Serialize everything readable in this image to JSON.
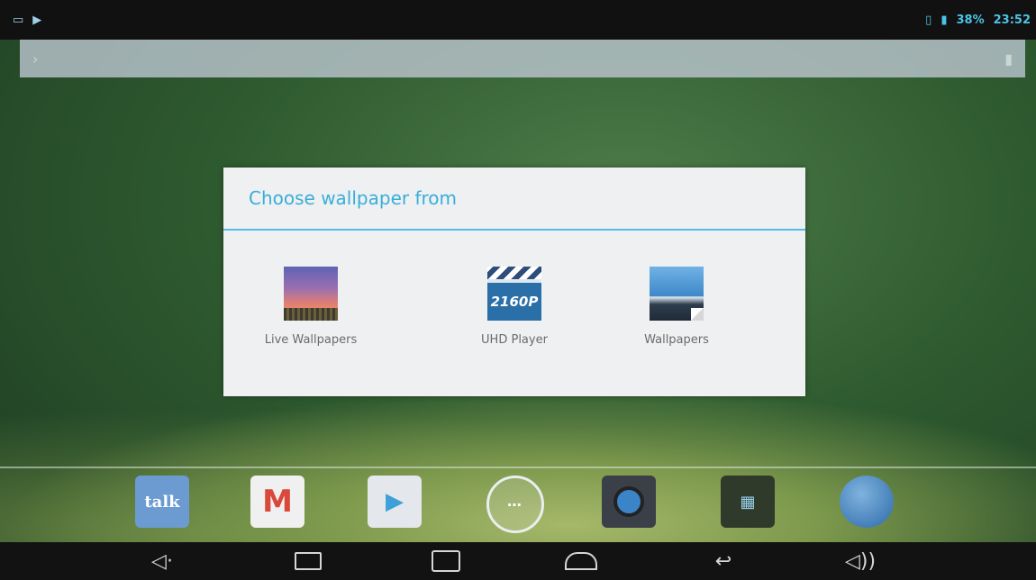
{
  "statusbar": {
    "battery_text": "38%",
    "time": "23:52"
  },
  "dialog": {
    "title": "Choose wallpaper from",
    "options": [
      {
        "label": "Live Wallpapers",
        "icon": "live-wallpapers-icon"
      },
      {
        "label": "UHD Player",
        "icon": "uhd-player-icon",
        "icon_text": "2160P"
      },
      {
        "label": "Wallpapers",
        "icon": "wallpapers-icon"
      }
    ]
  },
  "dock": {
    "items": [
      {
        "name": "talk",
        "text": "talk"
      },
      {
        "name": "gmail",
        "text": "M"
      },
      {
        "name": "play-store",
        "text": "▶"
      },
      {
        "name": "all-apps",
        "text": "⋯"
      },
      {
        "name": "camera"
      },
      {
        "name": "gallery",
        "text": "▦"
      },
      {
        "name": "browser"
      }
    ]
  },
  "navbar": {
    "volume_down": "◁·",
    "volume_up": "◁))"
  }
}
